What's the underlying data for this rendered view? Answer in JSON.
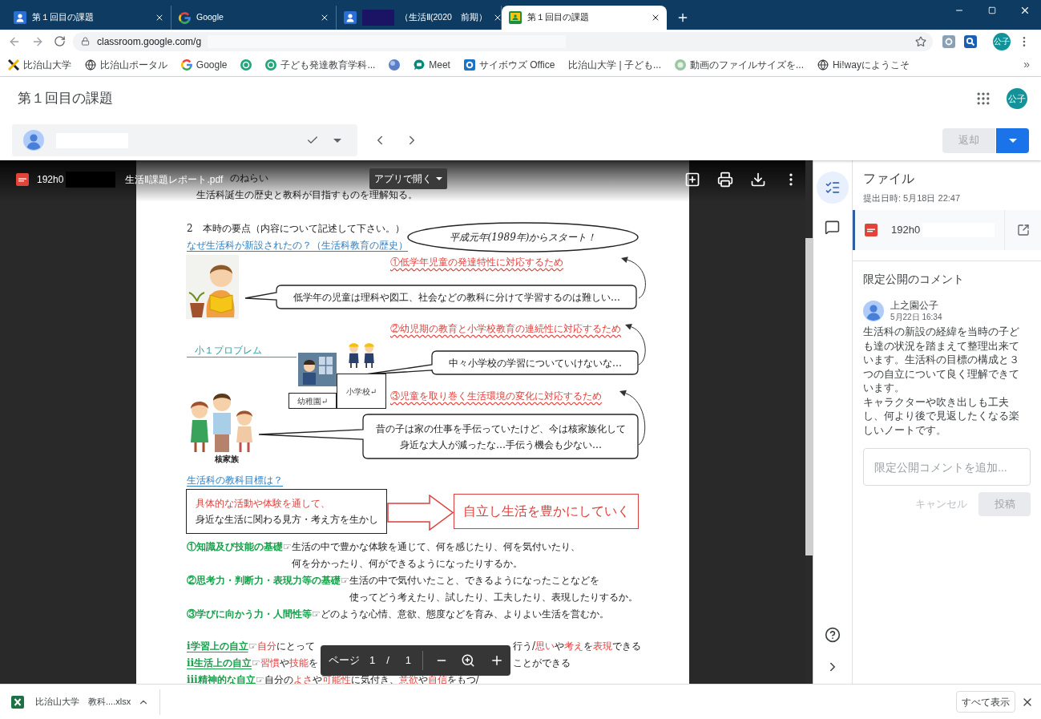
{
  "browser": {
    "tabs": [
      {
        "kind": "people",
        "title": "第１回目の課題",
        "selected": false,
        "redacted": false
      },
      {
        "kind": "letter",
        "title": "Google",
        "selected": false,
        "redacted": false
      },
      {
        "kind": "people",
        "title": "（生活Ⅱ(2020　前期）",
        "selected": false,
        "redacted": true
      },
      {
        "kind": "board",
        "title": "第１回目の課題",
        "selected": true,
        "redacted": false
      }
    ],
    "address": {
      "url": "classroom.google.com/g",
      "redacted": true
    },
    "profile": "公子",
    "bookmarks": [
      {
        "kind": "mark",
        "label": "比治山大学"
      },
      {
        "kind": "globe",
        "label": "比治山ポータル"
      },
      {
        "kind": "letter",
        "label": "Google"
      },
      {
        "kind": "ring"
      },
      {
        "kind": "ring",
        "label": "子ども発達教育学科..."
      },
      {
        "kind": "sphere"
      },
      {
        "kind": "bubble",
        "label": "Meet"
      },
      {
        "kind": "tile",
        "label": "サイボウズ Office"
      },
      {
        "kind": "blank",
        "label": "比治山大学 | 子ども..."
      },
      {
        "kind": "disc",
        "label": "動画のファイルサイズを..."
      },
      {
        "kind": "globe",
        "label": "Hi!wayにようこそ"
      }
    ],
    "bookmarks_overflow": "»"
  },
  "header": {
    "title": "第１回目の課題",
    "avatar": "公子",
    "student": {
      "redacted": true
    },
    "return_button": {
      "label": "返却",
      "disabled": true
    }
  },
  "viewer": {
    "file_id": "192h0",
    "redacted": true,
    "file_name": "生活Ⅱ課題レポート.pdf",
    "open_with": "アプリで開く",
    "document": {
      "heading_fragment": "のねらい",
      "aim": "生活科誕生の歴史と教科が目指すものを理解知る。",
      "section_title": "2　本時の要点（内容について記述して下さい。）",
      "callout": "平成元年(1989年)からスタート！",
      "question": "なぜ生活科が新設されたの？（生活科教育の歴史）",
      "reasons": [
        {
          "label": "①低学年児童の発達特性に対応するため",
          "bubble": [
            "低学年の児童は理科や図工、社会などの教科に分けて学習するのは難しい…"
          ]
        },
        {
          "label": "②幼児期の教育と小学校教育の連続性に対応するため",
          "bubble": [
            "中々小学校の学習についていけないな…"
          ]
        },
        {
          "label": "③児童を取り巻く生活環境の変化に対応するため",
          "bubble": [
            "昔の子は家の仕事を手伝っていたけど、今は核家族化して",
            "身近な大人が減ったな…手伝う機会も少ない…"
          ]
        }
      ],
      "problem_label": "小１プロブレム",
      "school_labels": [
        "幼稚園↵",
        "小学校↵"
      ],
      "family_caption": "核家族",
      "goal_question": "生活科の教科目標は？",
      "goal_text": [
        {
          "kind": "accent",
          "text": "具体的な活動や体験を通して、"
        },
        {
          "kind": "plain",
          "text": "身近な生活に関わる見方・考え方を生かし"
        }
      ],
      "goal_result": "自立し生活を豊かにしていく",
      "abilities": [
        {
          "label": "①知識及び技能の基礎",
          "pointer": "☞",
          "lines": [
            "生活の中で豊かな体験を通じて、何を感じたり、何を気付いたり、",
            "何を分かったり、何ができるようになったりするか。"
          ]
        },
        {
          "label": "②思考力・判断力・表現力等の基礎",
          "pointer": "☞",
          "lines": [
            "生活の中で気付いたこと、できるようになったことなどを",
            "使ってどう考えたり、試したり、工夫したり、表現したりするか。"
          ]
        },
        {
          "label": "③学びに向かう力・人間性等",
          "pointer": "☞",
          "lines": [
            "どのような心情、意欲、態度などを育み、よりよい生活を営むか。"
          ]
        }
      ],
      "autonomy": [
        {
          "label": "ⅰ学習上の自立",
          "pointer": "☞",
          "segments": [
            {
              "kind": "accent",
              "text": "自分"
            },
            {
              "kind": "plain",
              "text": "にとって"
            }
          ],
          "tail_segments": [
            {
              "kind": "plain",
              "text": "行う/"
            },
            {
              "kind": "accent",
              "text": "思い"
            },
            {
              "kind": "plain",
              "text": "や"
            },
            {
              "kind": "accent",
              "text": "考え"
            },
            {
              "kind": "plain",
              "text": "を"
            },
            {
              "kind": "accent",
              "text": "表現"
            },
            {
              "kind": "plain",
              "text": "できる"
            }
          ]
        },
        {
          "label": "ⅱ生活上の自立",
          "pointer": "☞",
          "segments": [
            {
              "kind": "accent",
              "text": "習慣"
            },
            {
              "kind": "plain",
              "text": "や"
            },
            {
              "kind": "accent",
              "text": "技能"
            },
            {
              "kind": "plain",
              "text": "を"
            }
          ],
          "tail_segments": [
            {
              "kind": "plain",
              "text": "ことができる"
            }
          ]
        },
        {
          "label": "ⅲ精神的な自立",
          "pointer": "☞",
          "segments": [
            {
              "kind": "plain",
              "text": "自分の"
            },
            {
              "kind": "accent",
              "text": "よさ"
            },
            {
              "kind": "plain",
              "text": "や"
            },
            {
              "kind": "accent",
              "text": "可能性"
            },
            {
              "kind": "plain",
              "text": "に気付き、"
            },
            {
              "kind": "accent",
              "text": "意欲"
            },
            {
              "kind": "plain",
              "text": "や"
            },
            {
              "kind": "accent",
              "text": "自信"
            },
            {
              "kind": "plain",
              "text": "をもつ/"
            }
          ]
        }
      ]
    },
    "page_nav": {
      "label": "ページ",
      "current": "1",
      "separator": "/",
      "total": "1"
    }
  },
  "side_rail": [
    {
      "kind": "checklist",
      "selected": true
    },
    {
      "kind": "comment",
      "selected": false
    }
  ],
  "submission": {
    "title": "ファイル",
    "submitted": "提出日時: 5月18日 22:47",
    "attachments": [
      {
        "name": "192h0",
        "redacted": true
      }
    ]
  },
  "comments": {
    "title": "限定公開のコメント",
    "items": [
      {
        "author": "上之園公子",
        "time": "5月22日 16:34",
        "body": [
          "生活科の新設の経緯を当時の子ども達の状況を踏まえて整理出来ています。生活科の目標の構成と３つの自立について良く理解できています。",
          "キャラクターや吹き出しも工夫し、何より後で見返したくなる楽しいノートです。"
        ]
      }
    ],
    "input": {
      "placeholder": "限定公開コメントを追加..."
    },
    "cancel": {
      "label": "キャンセル",
      "disabled": true
    },
    "post": {
      "label": "投稿",
      "disabled": true
    }
  },
  "downloads": {
    "items": [
      {
        "name": "比治山大学　教科....xlsx"
      }
    ],
    "show_all": "すべて表示"
  }
}
